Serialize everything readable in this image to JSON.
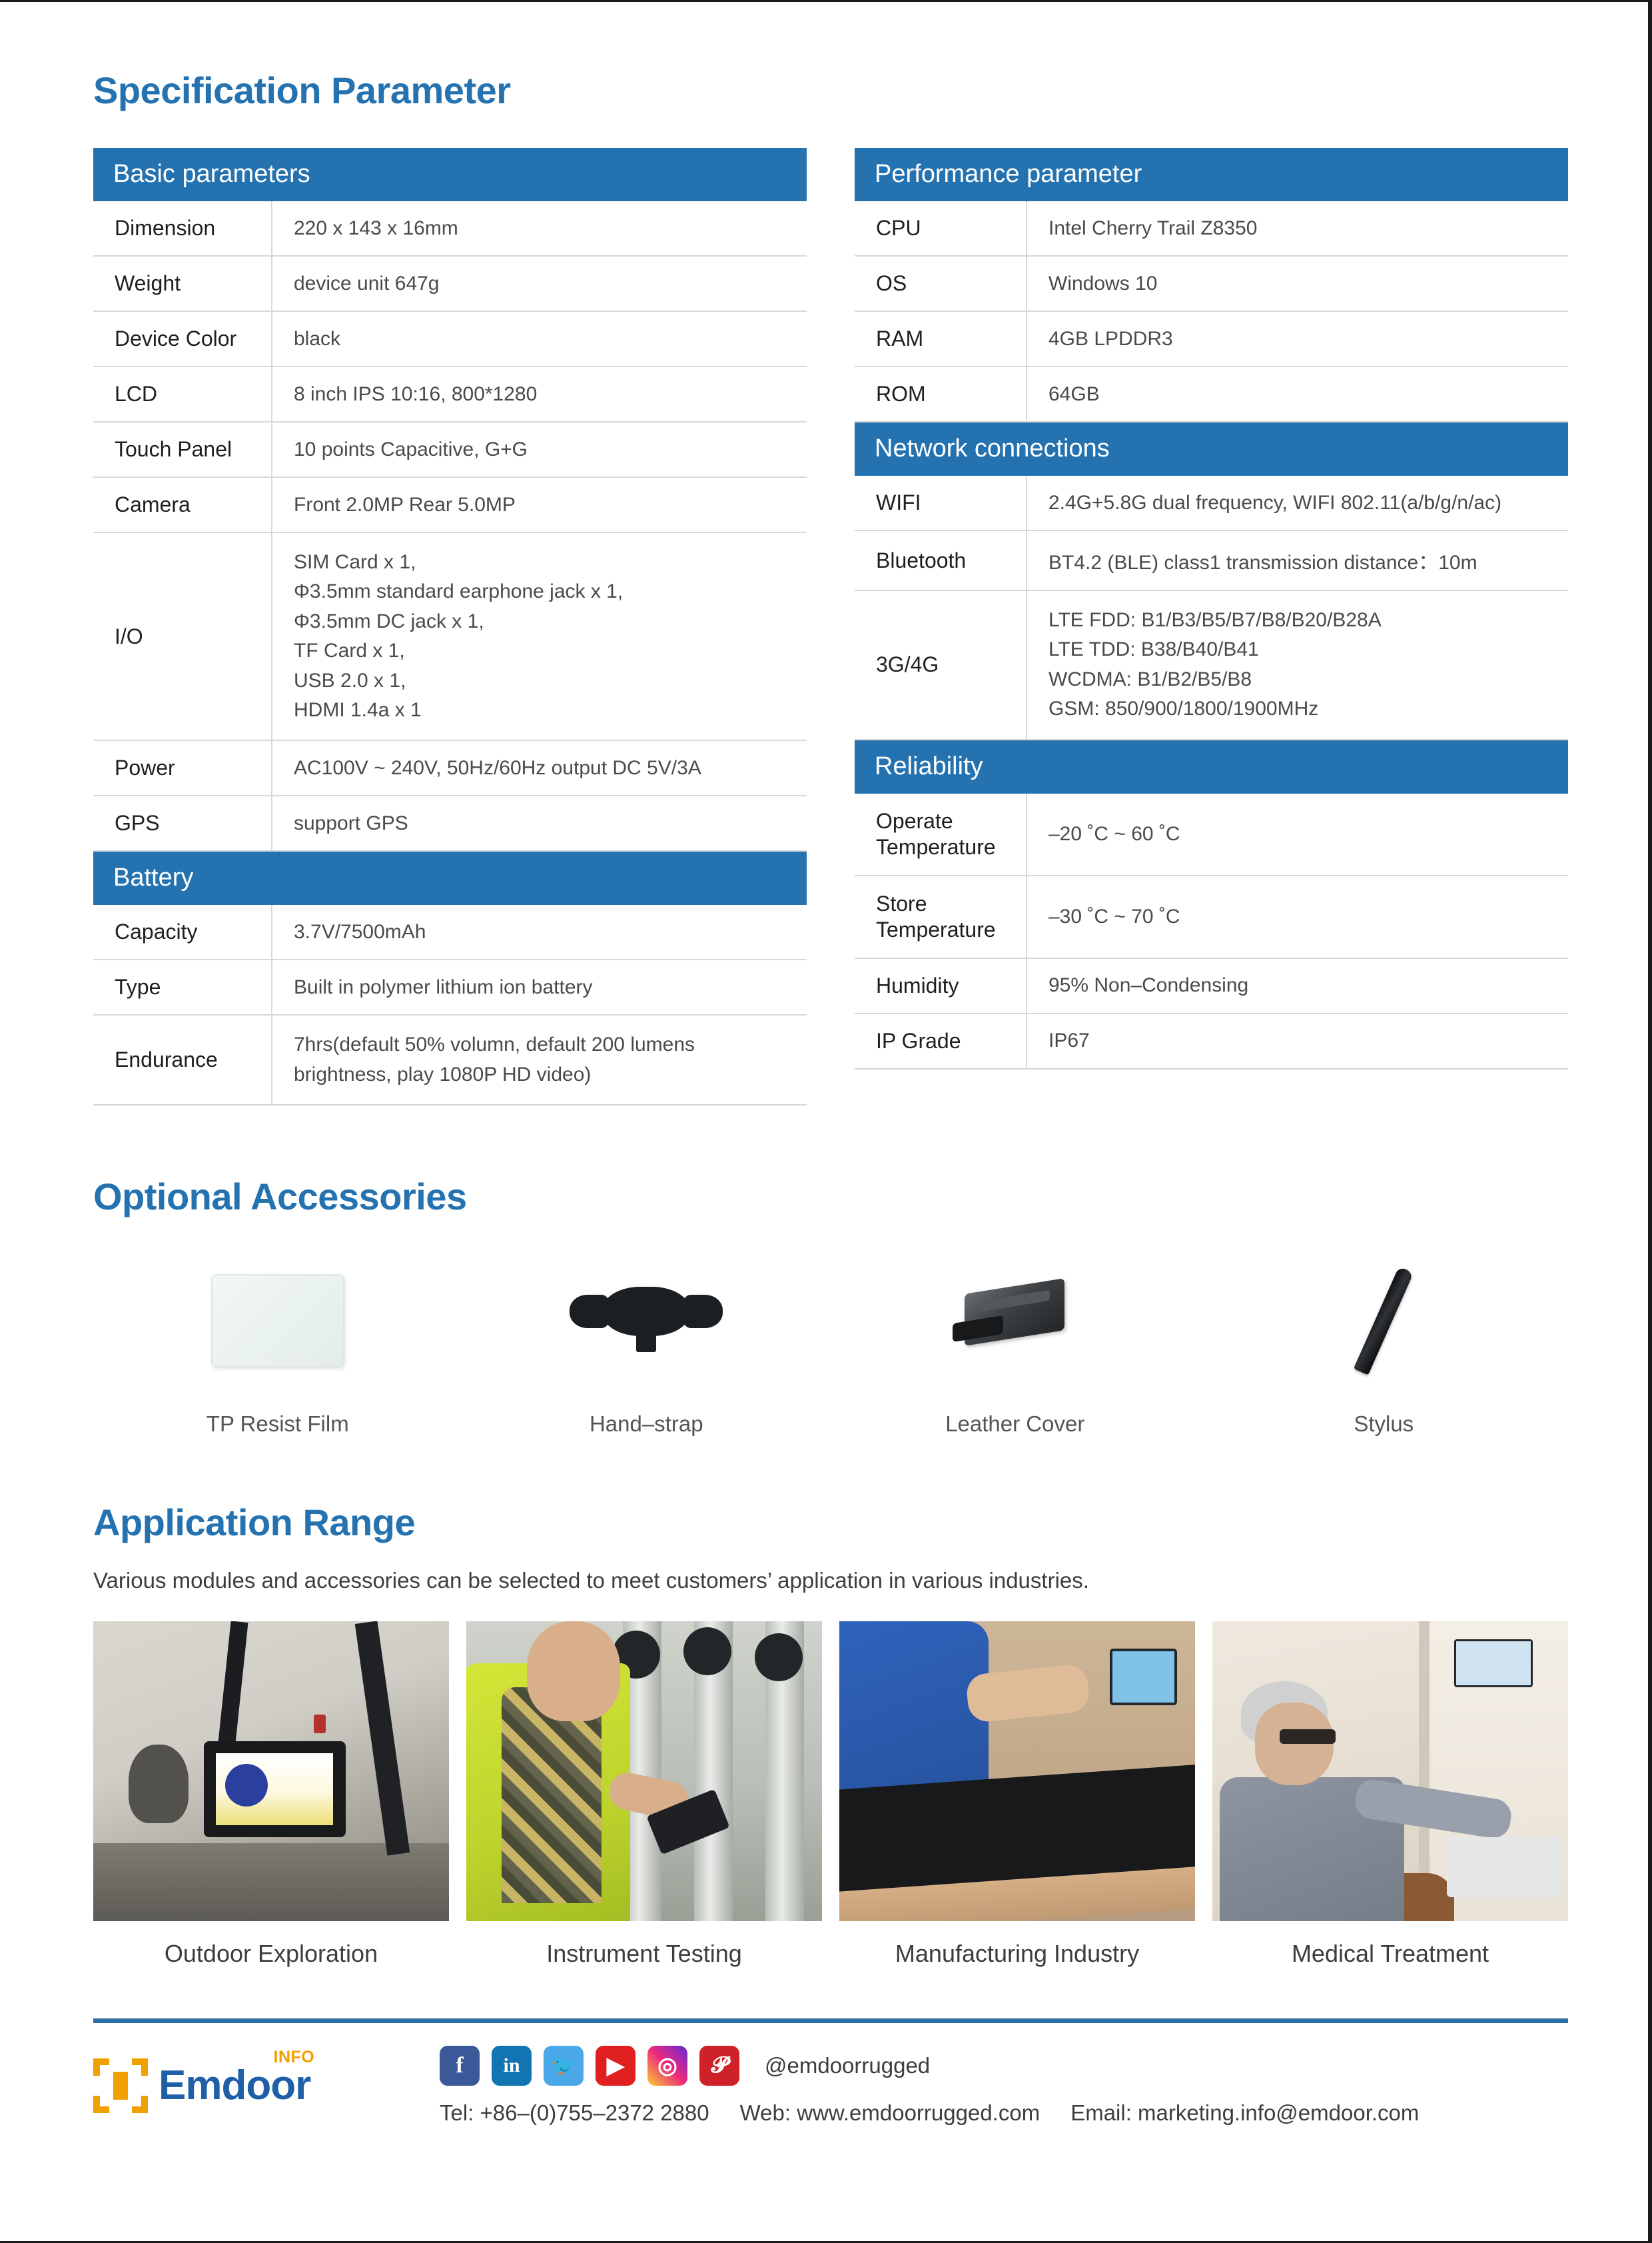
{
  "sections": {
    "spec_title": "Specification Parameter",
    "accessories_title": "Optional Accessories",
    "application_title": "Application Range",
    "application_desc": "Various modules and accessories can be selected to meet customers’ application in various industries."
  },
  "basic": {
    "header": "Basic parameters",
    "rows": [
      {
        "key": "Dimension",
        "value": "220 x 143 x 16mm"
      },
      {
        "key": "Weight",
        "value": "device unit 647g"
      },
      {
        "key": "Device Color",
        "value": "black"
      },
      {
        "key": "LCD",
        "value": "8 inch IPS 10:16,  800*1280"
      },
      {
        "key": "Touch Panel",
        "value": "10 points Capacitive, G+G"
      },
      {
        "key": "Camera",
        "value": "Front 2.0MP Rear 5.0MP"
      }
    ],
    "io_key": "I/O",
    "io_lines": [
      "SIM Card x 1,",
      "Φ3.5mm standard earphone jack x 1,",
      "Φ3.5mm DC jack x 1,",
      "TF Card x 1,",
      "USB 2.0 x 1,",
      "HDMI 1.4a x 1"
    ],
    "rows_after_io": [
      {
        "key": "Power",
        "value": "AC100V ~ 240V, 50Hz/60Hz output DC 5V/3A"
      },
      {
        "key": "GPS",
        "value": "support GPS"
      }
    ]
  },
  "battery": {
    "header": "Battery",
    "rows": [
      {
        "key": "Capacity",
        "value": "3.7V/7500mAh"
      },
      {
        "key": "Type",
        "value": "Built in polymer lithium ion battery"
      }
    ],
    "endurance_key": "Endurance",
    "endurance_lines": [
      "7hrs(default 50% volumn,  default 200 lumens",
      "brightness, play 1080P HD video)"
    ]
  },
  "performance": {
    "header": "Performance parameter",
    "rows": [
      {
        "key": "CPU",
        "value": "Intel Cherry Trail Z8350"
      },
      {
        "key": "OS",
        "value": "Windows 10"
      },
      {
        "key": "RAM",
        "value": "4GB  LPDDR3"
      },
      {
        "key": "ROM",
        "value": "64GB"
      }
    ]
  },
  "network": {
    "header": "Network connections",
    "rows": [
      {
        "key": "WIFI",
        "value": "2.4G+5.8G dual frequency, WIFI 802.11(a/b/g/n/ac)"
      },
      {
        "key": "Bluetooth",
        "value": "BT4.2 (BLE) class1 transmission distance：10m"
      }
    ],
    "cellular_key": "3G/4G",
    "cellular_lines": [
      "LTE FDD: B1/B3/B5/B7/B8/B20/B28A",
      "LTE TDD: B38/B40/B41",
      "WCDMA: B1/B2/B5/B8",
      "GSM: 850/900/1800/1900MHz"
    ]
  },
  "reliability": {
    "header": "Reliability",
    "operate_key_line1": "Operate",
    "operate_key_line2": "Temperature",
    "operate_value": "–20 ˚C ~ 60 ˚C",
    "store_key_line1": "Store",
    "store_key_line2": "Temperature",
    "store_value": "–30 ˚C ~ 70 ˚C",
    "rows": [
      {
        "key": "Humidity",
        "value": "95% Non–Condensing"
      },
      {
        "key": "IP Grade",
        "value": "IP67"
      }
    ]
  },
  "accessories": [
    {
      "label": "TP Resist Film"
    },
    {
      "label": "Hand–strap"
    },
    {
      "label": "Leather Cover"
    },
    {
      "label": "Stylus"
    }
  ],
  "applications": [
    {
      "caption": "Outdoor Exploration"
    },
    {
      "caption": "Instrument Testing"
    },
    {
      "caption": "Manufacturing Industry"
    },
    {
      "caption": "Medical Treatment"
    }
  ],
  "footer": {
    "logo_word": "Emdoor",
    "logo_badge": "INFO",
    "social_handle": "@emdoorrugged",
    "tel": "Tel: +86–(0)755–2372 2880",
    "web": "Web: www.emdoorrugged.com",
    "email": "Email: marketing.info@emdoor.com",
    "icons": {
      "facebook": "f",
      "linkedin": "in",
      "twitter": "🐦",
      "youtube": "▶",
      "instagram": "◎",
      "pinterest": "𝓟"
    }
  },
  "colors": {
    "header_blue": "#2472b0",
    "title_blue": "#2472b0",
    "rule_blue": "#2b6ea8",
    "logo_orange": "#f0a000"
  }
}
